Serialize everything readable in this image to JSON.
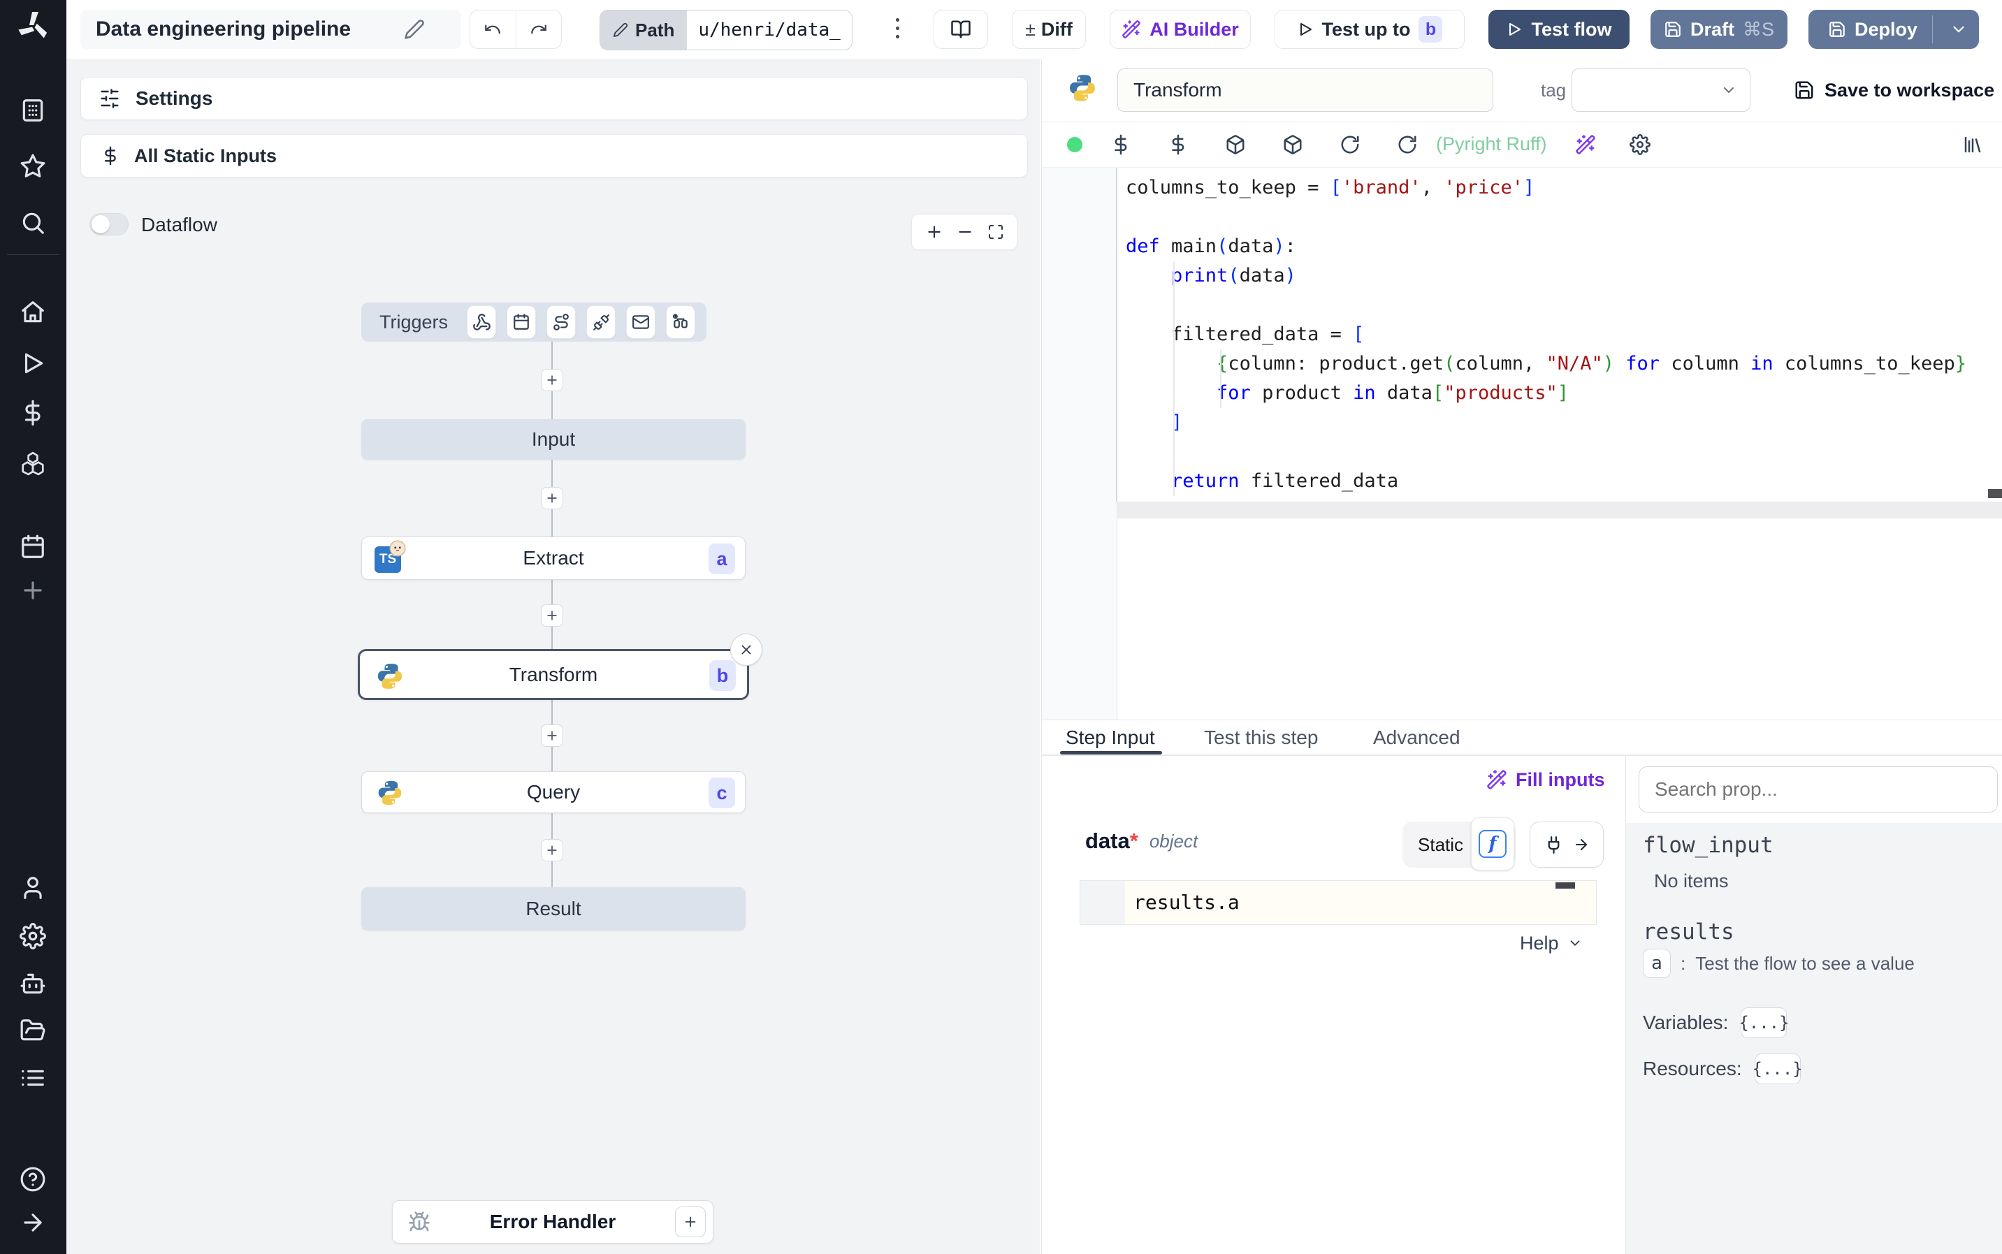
{
  "topbar": {
    "title": "Data engineering pipeline",
    "path_label": "Path",
    "path_value": "u/henri/data_",
    "diff_sign": "±",
    "diff_label": "Diff",
    "ai_builder_label": "AI Builder",
    "test_up_to_label": "Test up to",
    "test_up_to_badge": "b",
    "test_flow_label": "Test flow",
    "draft_label": "Draft",
    "draft_shortcut": "⌘S",
    "deploy_label": "Deploy"
  },
  "sidebar": {
    "icons": [
      "windmill-logo",
      "workspace",
      "favorites",
      "search",
      "home",
      "runs",
      "variables",
      "resources",
      "schedules",
      "add",
      "user",
      "settings",
      "workers",
      "folders",
      "logs",
      "help",
      "expand"
    ]
  },
  "flow": {
    "settings_label": "Settings",
    "static_inputs_label": "All Static Inputs",
    "dataflow_label": "Dataflow",
    "triggers_label": "Triggers",
    "trigger_icons": [
      "webhook",
      "schedule",
      "route",
      "websocket",
      "email",
      "poll"
    ],
    "nodes": {
      "input": {
        "label": "Input"
      },
      "extract": {
        "label": "Extract",
        "badge": "a",
        "language": "bun-typescript"
      },
      "transform": {
        "label": "Transform",
        "badge": "b",
        "language": "python",
        "selected": true
      },
      "query": {
        "label": "Query",
        "badge": "c",
        "language": "python"
      },
      "result": {
        "label": "Result"
      }
    },
    "error_handler_label": "Error Handler"
  },
  "editor": {
    "step_name": "Transform",
    "tag_label": "tag",
    "save_label": "Save to workspace",
    "lint_text": "(Pyright Ruff)",
    "status_color": "#4ade80",
    "code_lines": [
      [
        [
          "d",
          "columns_to_keep = "
        ],
        [
          "bb",
          "["
        ],
        [
          "s",
          "'brand'"
        ],
        [
          "d",
          ", "
        ],
        [
          "s",
          "'price'"
        ],
        [
          "bb",
          "]"
        ]
      ],
      [],
      [
        [
          "k",
          "def"
        ],
        [
          "d",
          " main"
        ],
        [
          "bb",
          "("
        ],
        [
          "d",
          "data"
        ],
        [
          "bb",
          ")"
        ],
        [
          "d",
          ":"
        ]
      ],
      [
        [
          "d",
          "    "
        ],
        [
          "k",
          "print"
        ],
        [
          "bb",
          "("
        ],
        [
          "d",
          "data"
        ],
        [
          "bb",
          ")"
        ]
      ],
      [],
      [
        [
          "d",
          "    filtered_data = "
        ],
        [
          "bb",
          "["
        ]
      ],
      [
        [
          "d",
          "        "
        ],
        [
          "bg",
          "{"
        ],
        [
          "d",
          "column: product.get"
        ],
        [
          "bg",
          "("
        ],
        [
          "d",
          "column, "
        ],
        [
          "s",
          "\"N/A\""
        ],
        [
          "bg",
          ")"
        ],
        [
          "d",
          " "
        ],
        [
          "k",
          "for"
        ],
        [
          "d",
          " column "
        ],
        [
          "k",
          "in"
        ],
        [
          "d",
          " columns_to_keep"
        ],
        [
          "bg",
          "}"
        ]
      ],
      [
        [
          "d",
          "        "
        ],
        [
          "k",
          "for"
        ],
        [
          "d",
          " product "
        ],
        [
          "k",
          "in"
        ],
        [
          "d",
          " data"
        ],
        [
          "bg",
          "["
        ],
        [
          "s",
          "\"products\""
        ],
        [
          "bg",
          "]"
        ]
      ],
      [
        [
          "d",
          "    "
        ],
        [
          "bb",
          "]"
        ]
      ],
      [],
      [
        [
          "d",
          "    "
        ],
        [
          "k",
          "return"
        ],
        [
          "d",
          " filtered_data"
        ]
      ]
    ]
  },
  "tabs": {
    "step_input": "Step Input",
    "test_step": "Test this step",
    "advanced": "Advanced"
  },
  "step_input": {
    "fill_inputs_label": "Fill inputs",
    "field_name": "data",
    "field_required_mark": "*",
    "field_type": "object",
    "static_label": "Static",
    "expr_value": "results.a",
    "help_label": "Help"
  },
  "props": {
    "search_placeholder": "Search prop...",
    "flow_input_label": "flow_input",
    "flow_input_empty": "No items",
    "results_label": "results",
    "result_key": "a",
    "result_separator": ":",
    "result_hint": "Test the flow to see a value",
    "variables_label": "Variables:",
    "resources_label": "Resources:",
    "object_badge": "{...}"
  },
  "colors": {
    "accent_purple": "#6d28d9",
    "primary_dark_button": "#3c4f70",
    "secondary_slate_button": "#617699",
    "key_badge_bg": "#e3e8fd",
    "key_badge_text": "#4f46e5",
    "lint_green": "#7fce9f",
    "status_green": "#4ade80",
    "node_bar_bg": "#dbe2ec",
    "required_red": "#ef4444"
  }
}
